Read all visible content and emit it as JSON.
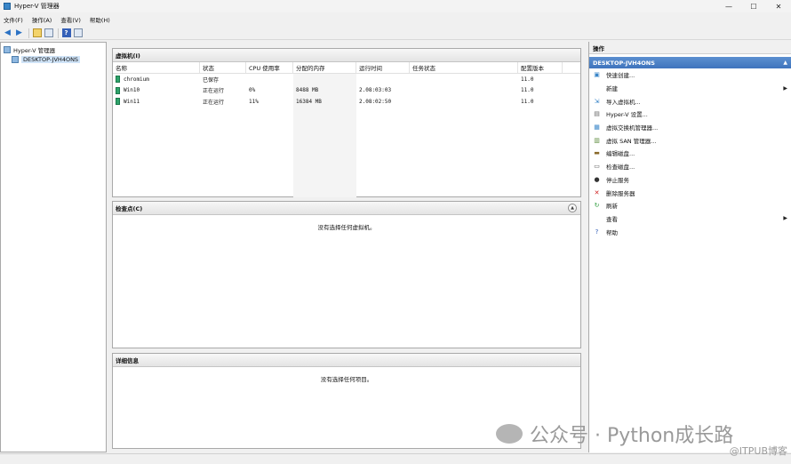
{
  "window": {
    "title": "Hyper-V 管理器",
    "controls": [
      "—",
      "☐",
      "✕"
    ]
  },
  "menu": [
    "文件(F)",
    "操作(A)",
    "查看(V)",
    "帮助(H)"
  ],
  "toolbar": {
    "back": "◀",
    "forward": "▶",
    "help": "?"
  },
  "tree": {
    "root": "Hyper-V 管理器",
    "server": "DESKTOP-JVH4ONS"
  },
  "vm_pane": {
    "title": "虚拟机(I)",
    "columns": [
      "名称",
      "状态",
      "CPU 使用率",
      "分配的内存",
      "运行时间",
      "任务状态",
      "配置版本"
    ],
    "rows": [
      {
        "name": "chromium",
        "status": "已保存",
        "cpu": "",
        "memory": "",
        "uptime": "",
        "task": "",
        "version": "11.0"
      },
      {
        "name": "Win10",
        "status": "正在运行",
        "cpu": "0%",
        "memory": "8488 MB",
        "uptime": "2.08:03:03",
        "task": "",
        "version": "11.0"
      },
      {
        "name": "Win11",
        "status": "正在运行",
        "cpu": "11%",
        "memory": "16384 MB",
        "uptime": "2.08:02:50",
        "task": "",
        "version": "11.0"
      }
    ]
  },
  "checkpoint_pane": {
    "title": "检查点(C)",
    "empty": "没有选择任何虚拟机。"
  },
  "details_pane": {
    "title": "详细信息",
    "empty": "没有选择任何项目。"
  },
  "actions": {
    "header": "操作",
    "section": "DESKTOP-JVH4ONS",
    "items": [
      {
        "label": "快速创建...",
        "icon": "quick-create-icon",
        "arrow": false
      },
      {
        "label": "新建",
        "icon": "",
        "arrow": true
      },
      {
        "label": "导入虚拟机...",
        "icon": "import-icon",
        "arrow": false
      },
      {
        "label": "Hyper-V 设置...",
        "icon": "settings-icon",
        "arrow": false
      },
      {
        "label": "虚拟交换机管理器...",
        "icon": "switch-icon",
        "arrow": false
      },
      {
        "label": "虚拟 SAN 管理器...",
        "icon": "san-icon",
        "arrow": false
      },
      {
        "label": "编辑磁盘...",
        "icon": "edit-disk-icon",
        "arrow": false
      },
      {
        "label": "检查磁盘...",
        "icon": "inspect-disk-icon",
        "arrow": false
      },
      {
        "label": "停止服务",
        "icon": "stop-icon",
        "arrow": false
      },
      {
        "label": "删除服务器",
        "icon": "delete-icon",
        "arrow": false
      },
      {
        "label": "刷新",
        "icon": "refresh-icon",
        "arrow": false
      },
      {
        "label": "查看",
        "icon": "",
        "arrow": true
      },
      {
        "label": "帮助",
        "icon": "help-icon",
        "arrow": false
      }
    ]
  },
  "watermark": {
    "main": "公众号 · Python成长路",
    "sub": "@ITPUB博客"
  },
  "colors": {
    "accent": "#3f74bd",
    "selection": "#cfe3f7",
    "vm_icon": "#2fa36b"
  }
}
